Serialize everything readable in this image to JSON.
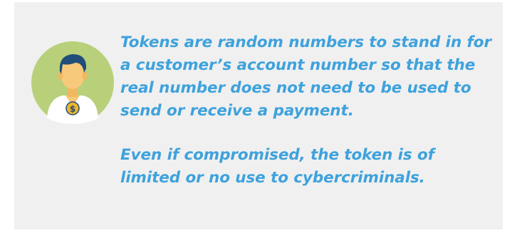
{
  "callout": {
    "icon": "customer-with-coin-icon",
    "colors": {
      "panel_background": "#f0f0f0",
      "text": "#3ea2dc",
      "icon_circle": "#b8d07a",
      "icon_hair": "#1f4e79",
      "icon_skin": "#f7c97a",
      "icon_coin": "#f0b429"
    },
    "paragraphs": [
      "Tokens are random numbers to stand in for a customer’s account number so that the real number does not need to be used to send or receive a payment.",
      "Even if compromised, the token is of limited or no use to cybercriminals."
    ],
    "coin_symbol": "$"
  }
}
